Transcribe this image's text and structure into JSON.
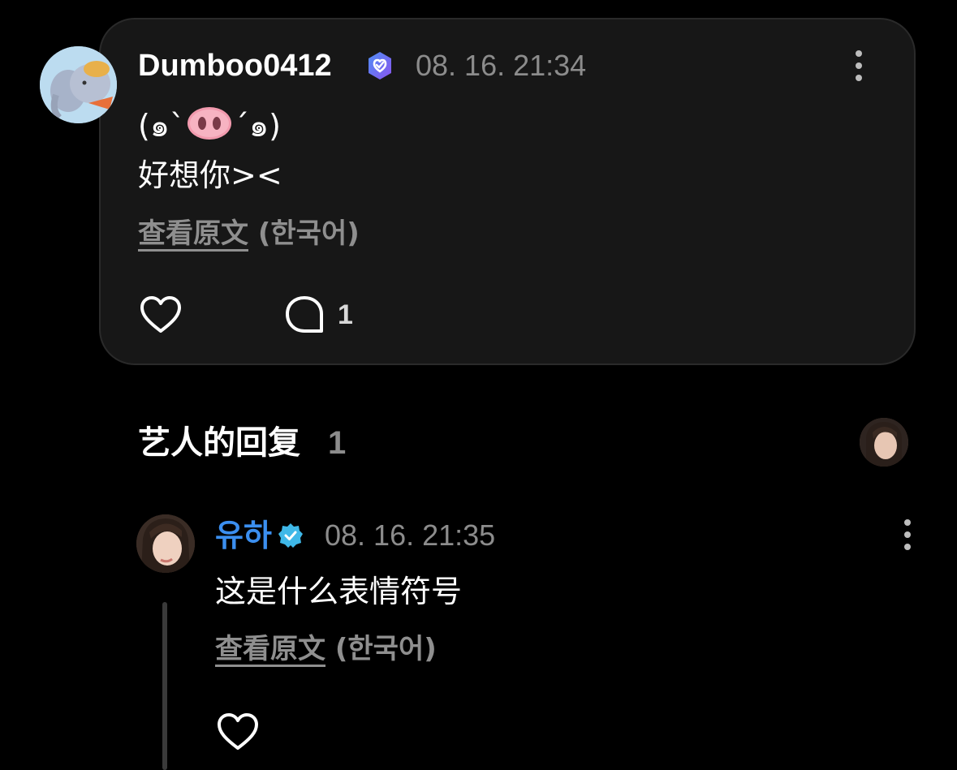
{
  "post": {
    "username": "Dumboo0412",
    "timestamp": "08. 16. 21:34",
    "emoticon_left": "(๑ˋ",
    "emoticon_right": "ˊ๑)",
    "text_line": "好想你><",
    "view_original_label": "查看原文",
    "language_label": "(한국어)",
    "comment_count": "1",
    "icons": {
      "badge": "verified-heart-badge-icon",
      "more": "more-vertical-icon",
      "like": "heart-outline-icon",
      "comment": "comment-bubble-icon",
      "emoji": "pig-nose-emoji"
    },
    "colors": {
      "badge": "#6b6df2",
      "card_bg": "#171717"
    }
  },
  "replies_section": {
    "title": "艺人的回复",
    "count": "1"
  },
  "reply": {
    "artist_name": "유하",
    "timestamp": "08. 16. 21:35",
    "text": "这是什么表情符号",
    "view_original_label": "查看原文",
    "language_label": "(한국어)",
    "icons": {
      "badge": "verified-check-badge-icon",
      "more": "more-vertical-icon",
      "like": "heart-outline-icon"
    },
    "colors": {
      "name": "#3b8ff0",
      "badge": "#3fb8e8"
    }
  }
}
